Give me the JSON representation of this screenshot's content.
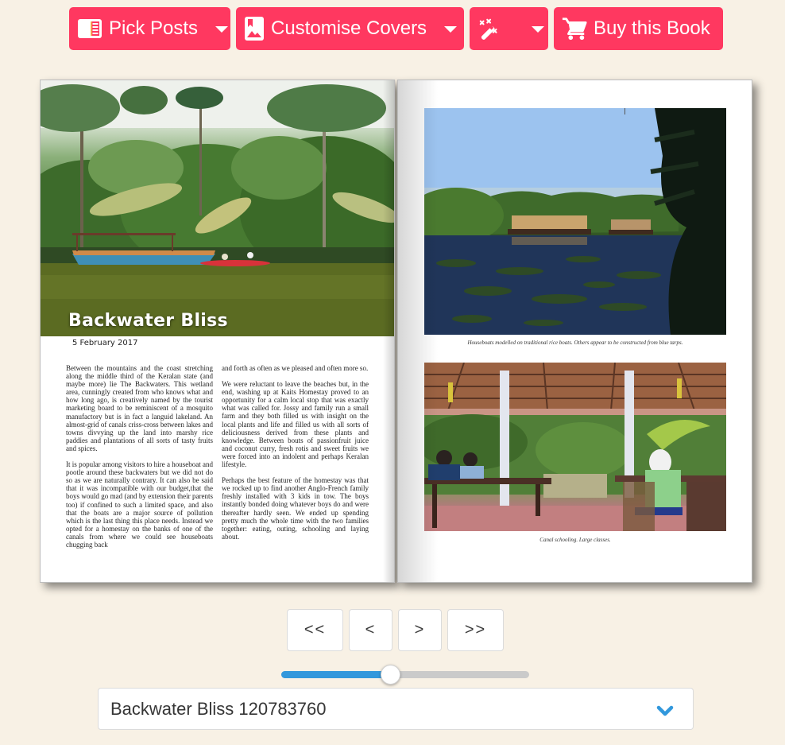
{
  "toolbar": {
    "pick_posts": {
      "label": "Pick Posts",
      "icon": "newspaper-icon"
    },
    "customise_covers": {
      "label": "Customise Covers",
      "icon": "image-bookmark-icon"
    },
    "magic": {
      "label": "",
      "icon": "magic-wand-icon"
    },
    "buy": {
      "label": "Buy this Book",
      "icon": "shopping-cart-icon"
    },
    "accent_color": "#ff3860"
  },
  "book": {
    "left_page": {
      "hero_image": "backwater-palms-boat-photo",
      "title": "Backwater Bliss",
      "date": "5 February 2017",
      "columns": [
        [
          "Between the mountains and the coast stretching along the middle third of the Keralan state (and maybe more) lie The Backwaters. This wetland area, cunningly created from who knows what and how long ago, is creatively named by the tourist marketing board to be reminiscent of a mosquito manufactory but is in fact a languid lakeland. An almost-grid of canals criss-cross between lakes and towns divvying up the land into marshy rice paddies and plantations of all sorts of tasty fruits and spices.",
          "It is popular among visitors to hire a houseboat and pootle around these backwaters but we did not do so as we are naturally contrary. It can also be said that it was incompatible with our budget,that the boys would go mad (and by extension their parents too) if confined to such a limited space, and also that the boats are a major source of pollution which is the last thing this place needs. Instead we opted for a homestay on the banks of one of the canals from where we could see houseboats chugging back"
        ],
        [
          "and forth as often as we pleased and often more so.",
          "We were reluctant to leave the beaches but, in the end, washing up at Kaits Homestay proved to an opportunity for a calm local stop that was exactly what was called for. Jossy and family run a small farm and they both filled us with insight on the local plants and life and filled us with all sorts of deliciousness derived from these plants and knowledge. Between bouts of passionfruit juice and coconut curry, fresh rotis and sweet fruits we were forced into an indolent and perhaps Keralan lifestyle.",
          "Perhaps the best feature of the homestay was that we rocked up to find another Anglo-French family freshly installed with 3 kids in tow. The boys instantly bonded doing whatever boys do and were thereafter hardly seen. We ended up spending pretty much the whole time with the two families together: eating, outing, schooling and laying about."
        ]
      ]
    },
    "right_page": {
      "photos": [
        {
          "image": "houseboats-lake-photo",
          "caption": "Houseboats modelled on traditional rice boats. Others appear to be constructed from blue tarps."
        },
        {
          "image": "canal-schooling-pavilion-photo",
          "caption": "Canal schooling. Large classes."
        }
      ]
    }
  },
  "navigation": {
    "first": "<<",
    "prev": "<",
    "next": ">",
    "last": ">>"
  },
  "slider": {
    "progress_percent": 44,
    "fill_color": "#3298dc"
  },
  "post_select": {
    "selected": "Backwater Bliss 120783760",
    "chevron_color": "#3298dc"
  }
}
